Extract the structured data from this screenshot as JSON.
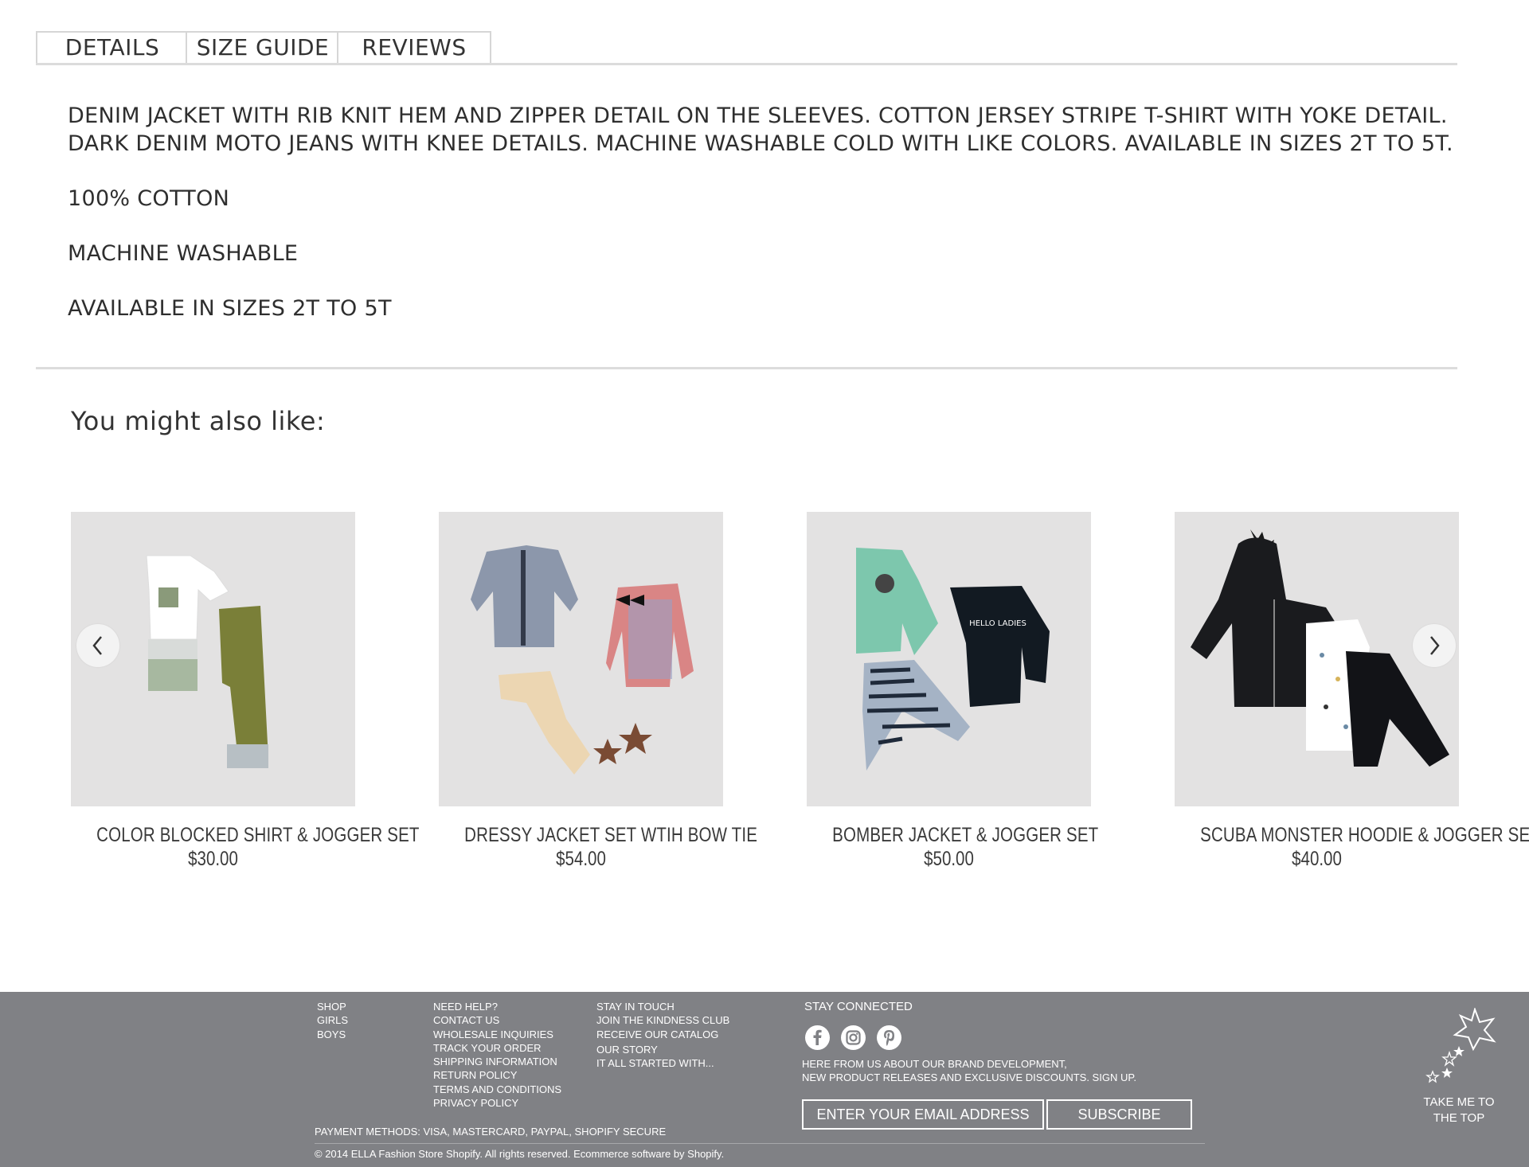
{
  "tabs": [
    {
      "label": "DETAILS"
    },
    {
      "label": "SIZE GUIDE"
    },
    {
      "label": "REVIEWS"
    }
  ],
  "details": {
    "description_line1": "DENIM JACKET WITH RIB KNIT HEM AND ZIPPER DETAIL ON THE SLEEVES. COTTON JERSEY STRIPE T-SHIRT WITH YOKE DETAIL.",
    "description_line2": "DARK DENIM MOTO JEANS WITH KNEE DETAILS. MACHINE WASHABLE COLD WITH LIKE COLORS. AVAILABLE IN SIZES 2T TO 5T.",
    "specs": [
      "100% COTTON",
      "MACHINE WASHABLE",
      "AVAILABLE IN SIZES 2T TO 5T"
    ]
  },
  "related": {
    "heading": "You might also like:",
    "products": [
      {
        "name": "COLOR BLOCKED SHIRT & JOGGER SET",
        "price": "$30.00"
      },
      {
        "name": "DRESSY JACKET SET WTIH BOW TIE",
        "price": "$54.00"
      },
      {
        "name": "BOMBER JACKET & JOGGER SET",
        "price": "$50.00"
      },
      {
        "name": "SCUBA MONSTER HOODIE & JOGGER SET",
        "price": "$40.00"
      }
    ],
    "prev_icon": "chevron-left-icon",
    "next_icon": "chevron-right-icon",
    "product_image_text": "HELLO LADIES"
  },
  "footer": {
    "shop": [
      "SHOP",
      "GIRLS",
      "BOYS"
    ],
    "help": [
      "NEED HELP?",
      "CONTACT US",
      "WHOLESALE INQUIRIES",
      "TRACK YOUR ORDER",
      "SHIPPING INFORMATION",
      "RETURN POLICY",
      "TERMS AND CONDITIONS",
      "PRIVACY POLICY"
    ],
    "touch": [
      "STAY IN TOUCH",
      "JOIN THE KINDNESS CLUB",
      "RECEIVE OUR CATALOG",
      "OUR STORY",
      "IT ALL STARTED WITH..."
    ],
    "stay_connected": "STAY CONNECTED",
    "social_icons": [
      "facebook-icon",
      "instagram-icon",
      "pinterest-icon"
    ],
    "hear_line1": "HERE FROM US ABOUT OUR BRAND DEVELOPMENT,",
    "hear_line2": "NEW PRODUCT RELEASES AND EXCLUSIVE DISCOUNTS. SIGN UP.",
    "email_placeholder": "ENTER YOUR EMAIL ADDRESS",
    "subscribe_label": "SUBSCRIBE",
    "payment": "PAYMENT METHODS: VISA, MASTERCARD, PAYPAL, SHOPIFY SECURE",
    "copyright": "© 2014 ELLA Fashion Store Shopify. All rights reserved. Ecommerce software by Shopify.",
    "to_top_line1": "TAKE ME TO",
    "to_top_line2": "THE TOP"
  },
  "colors": {
    "footer_bg": "#808185",
    "product_bg": "#e3e2e2",
    "divider": "#dcdcdc"
  }
}
